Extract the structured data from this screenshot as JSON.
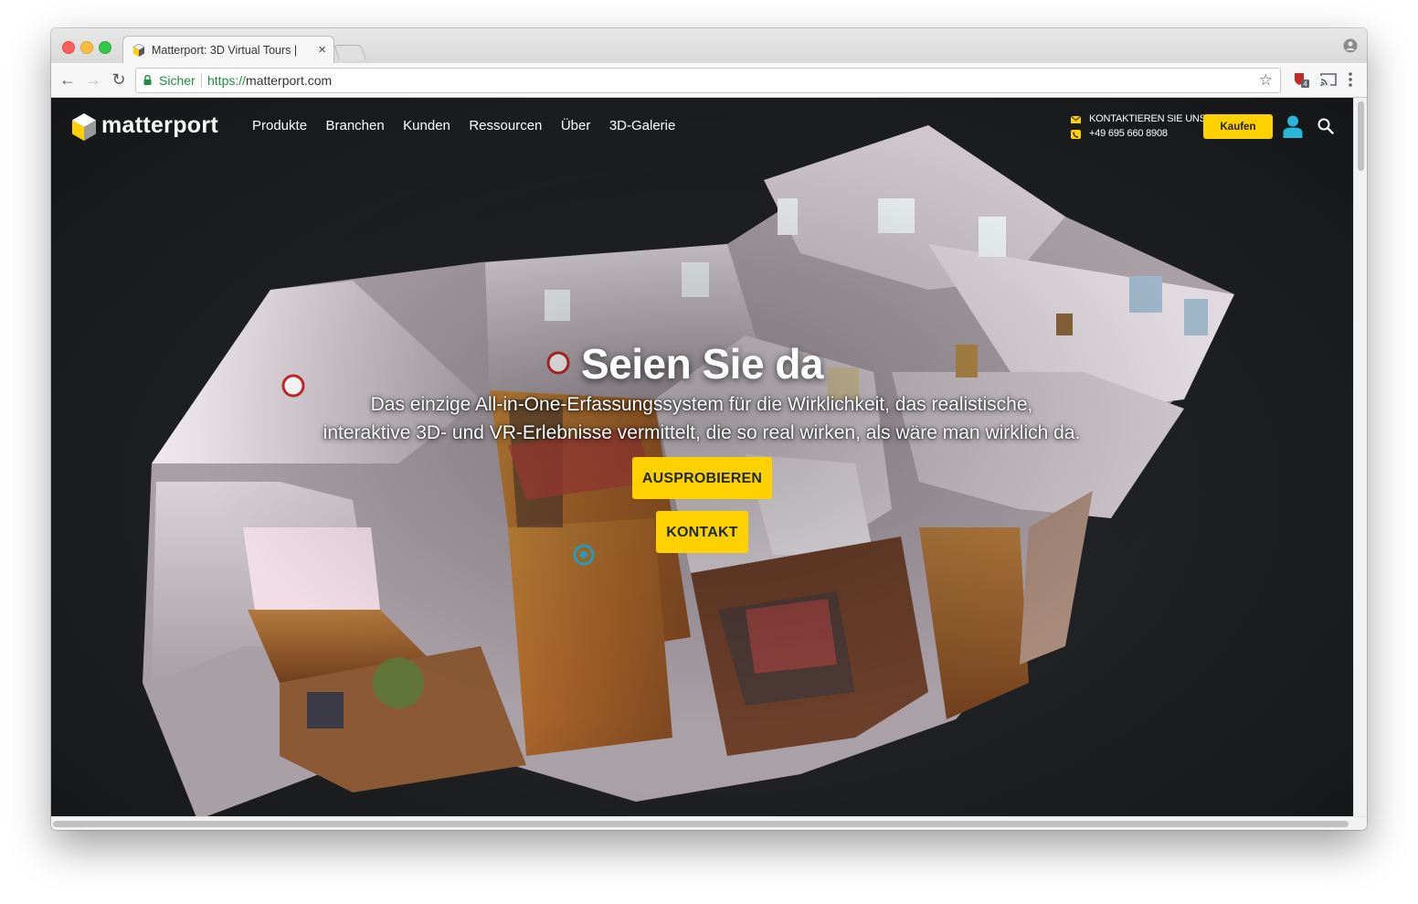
{
  "browser": {
    "tab_title": "Matterport: 3D Virtual Tours |",
    "tab_close": "×",
    "secure_label": "Sicher",
    "url_scheme": "https://",
    "url_host": "matterport.com",
    "extension_badge": "4"
  },
  "site": {
    "logo_text": "matterport",
    "nav": [
      "Produkte",
      "Branchen",
      "Kunden",
      "Ressourcen",
      "Über",
      "3D-Galerie"
    ],
    "contact_label": "KONTAKTIEREN SIE UNS",
    "contact_phone": "+49 695 660 8908",
    "buy_label": "Kaufen",
    "accent_color": "#ffd100",
    "user_icon_color": "#29b6d8"
  },
  "hero": {
    "title": "Seien Sie da",
    "subtitle_line1": "Das einzige All-in-One-Erfassungssystem für die Wirklichkeit, das realistische,",
    "subtitle_line2": "interaktive 3D- und VR-Erlebnisse vermittelt, die so real wirken, als wäre man wirklich da.",
    "cta_primary": "AUSPROBIEREN",
    "cta_secondary": "KONTAKT"
  }
}
